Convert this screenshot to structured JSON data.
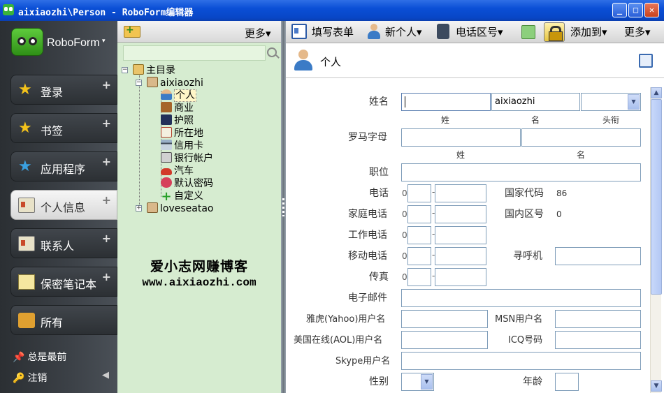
{
  "window": {
    "title": "aixiaozhi\\Person - RoboForm编辑器",
    "minimize": "_",
    "maximize": "□",
    "close": "✕"
  },
  "sidebar": {
    "brand": "RoboForm",
    "caret": "▾",
    "items": [
      {
        "label": "登录",
        "icon": "login-icon"
      },
      {
        "label": "书签",
        "icon": "bookmark-star-icon"
      },
      {
        "label": "应用程序",
        "icon": "application-icon"
      },
      {
        "label": "个人信息",
        "icon": "identity-card-icon",
        "active": true
      },
      {
        "label": "联系人",
        "icon": "contacts-icon"
      },
      {
        "label": "保密笔记本",
        "icon": "safenote-icon"
      },
      {
        "label": "所有",
        "icon": "all-icon"
      }
    ],
    "plus": "+",
    "footer": [
      {
        "label": "总是最前",
        "icon": "pin-icon"
      },
      {
        "label": "注销",
        "icon": "key-icon"
      }
    ],
    "collapse_arrow": "◀"
  },
  "tree": {
    "more": "更多▾",
    "search_placeholder": "",
    "root": "主目录",
    "folder": "aixiaozhi",
    "children": [
      "个人",
      "商业",
      "护照",
      "所在地",
      "信用卡",
      "银行帐户",
      "汽车",
      "默认密码",
      "自定义"
    ],
    "other_folder": "loveseatao"
  },
  "watermark": {
    "line1": "爱小志网赚博客",
    "line2": "www.aixiaozhi.com"
  },
  "toolbar": {
    "fill_form": "填写表单",
    "new_person": "新个人▾",
    "area_code": "电话区号▾",
    "add_to": "添加到▾",
    "more": "更多▾"
  },
  "header": {
    "title": "个人"
  },
  "form": {
    "name_label": "姓名",
    "first_name_value": "",
    "middle_name_value": "aixiaozhi",
    "title_select_value": "",
    "sub_last": "姓",
    "sub_first": "名",
    "sub_title": "头衔",
    "roman_label": "罗马字母",
    "roman_sub_last": "姓",
    "roman_sub_first": "名",
    "job_label": "职位",
    "phone_label": "电话",
    "country_code_label": "国家代码",
    "country_code_value": "86",
    "home_phone_label": "家庭电话",
    "area_code_label": "国内区号",
    "area_code_value": "0",
    "work_phone_label": "工作电话",
    "mobile_label": "移动电话",
    "pager_label": "寻呼机",
    "fax_label": "传真",
    "phone_prefix": "0",
    "email_label": "电子邮件",
    "yahoo_label": "雅虎(Yahoo)用户名",
    "msn_label": "MSN用户名",
    "aol_label": "美国在线(AOL)用户名",
    "icq_label": "ICQ号码",
    "skype_label": "Skype用户名",
    "gender_label": "性别",
    "age_label": "年龄"
  }
}
